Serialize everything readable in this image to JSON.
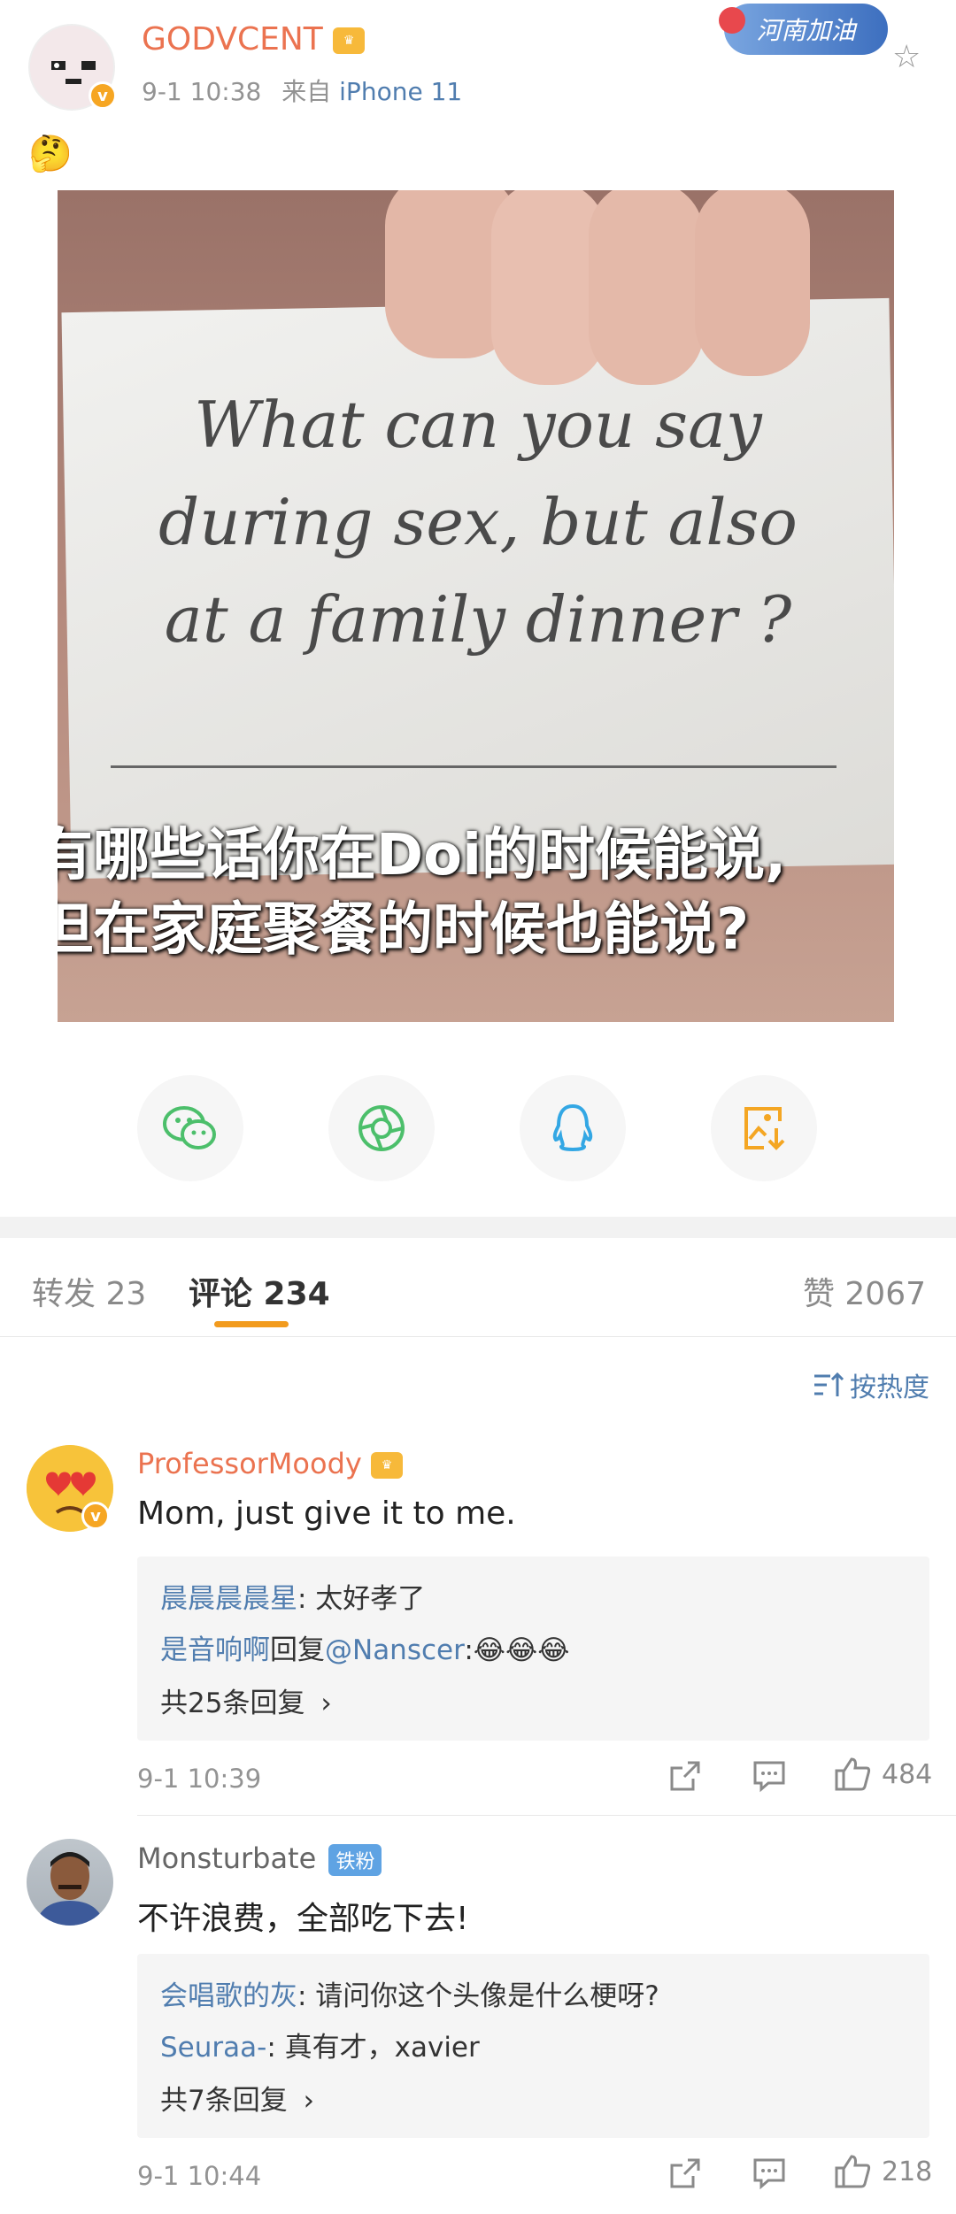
{
  "post": {
    "username": "GODVCENT",
    "date": "9-1 10:38",
    "source_prefix": "来自",
    "device": "iPhone 11",
    "topic_badge": "河南加油",
    "emoji_text": "🤔",
    "image_text_en": [
      "What can you say",
      "during sex, but also",
      "at a family dinner ?"
    ],
    "image_text_cn": [
      "有哪些话你在Doi的时候能说,",
      "但在家庭聚餐的时候也能说?"
    ]
  },
  "share_icons": [
    "wechat-icon",
    "moments-icon",
    "qq-icon",
    "save-image-icon"
  ],
  "tabs": {
    "repost": "转发 23",
    "comments": "评论 234",
    "likes": "赞 2067"
  },
  "sort_label": "按热度",
  "comments": [
    {
      "username": "ProfessorMoody",
      "text": "Mom, just give it to me.",
      "replies": [
        {
          "user": "晨晨晨晨星",
          "text": ": 太好孝了"
        },
        {
          "user": "是音响啊",
          "mid": "回复",
          "mention": "@Nanscer",
          "text": ":😂😂😂"
        }
      ],
      "more": "共25条回复",
      "time": "9-1 10:39",
      "likes": "484"
    },
    {
      "username": "Monsturbate",
      "badge": "铁粉",
      "text": "不许浪费，全部吃下去!",
      "replies": [
        {
          "user": "会唱歌的灰",
          "text": ": 请问你这个头像是什么梗呀?"
        },
        {
          "user": "Seuraa-",
          "text": ": 真有才，xavier"
        }
      ],
      "more": "共7条回复",
      "time": "9-1 10:44",
      "likes": "218"
    }
  ],
  "colors": {
    "accent": "#eb7350",
    "link": "#507daf",
    "tab_underline": "#f29b1e"
  }
}
